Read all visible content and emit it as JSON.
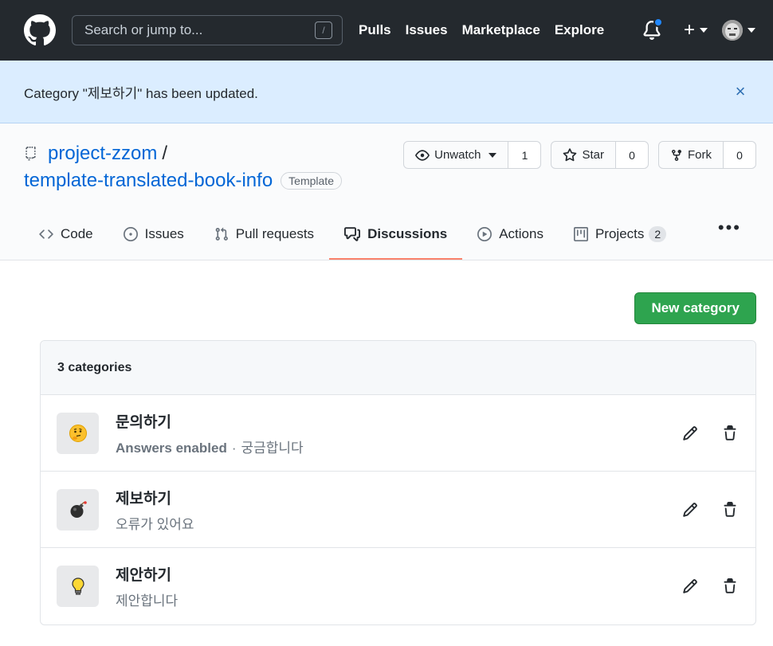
{
  "header": {
    "search_placeholder": "Search or jump to...",
    "search_shortcut": "/",
    "nav": [
      "Pulls",
      "Issues",
      "Marketplace",
      "Explore"
    ],
    "plus": "+"
  },
  "flash": {
    "message": "Category \"제보하기\" has been updated.",
    "close": "×"
  },
  "repo": {
    "owner": "project-zzom",
    "separator": "/",
    "name": "template-translated-book-info",
    "badge": "Template",
    "watch": {
      "label": "Unwatch",
      "count": "1"
    },
    "star": {
      "label": "Star",
      "count": "0"
    },
    "fork": {
      "label": "Fork",
      "count": "0"
    }
  },
  "tabs": [
    {
      "label": "Code"
    },
    {
      "label": "Issues"
    },
    {
      "label": "Pull requests"
    },
    {
      "label": "Discussions"
    },
    {
      "label": "Actions"
    },
    {
      "label": "Projects",
      "count": "2"
    }
  ],
  "more": "•••",
  "main": {
    "new_category_label": "New category",
    "categories_count_label": "3 categories",
    "categories": [
      {
        "emoji": "thinking-face",
        "title": "문의하기",
        "answers": "Answers enabled",
        "dot": "·",
        "description": "궁금합니다"
      },
      {
        "emoji": "bomb",
        "title": "제보하기",
        "description": "오류가 있어요"
      },
      {
        "emoji": "light-bulb",
        "title": "제안하기",
        "description": "제안합니다"
      }
    ]
  },
  "colors": {
    "header_bg": "#24292e",
    "flash_bg": "#dbedff",
    "link": "#0366d6",
    "accent_tab": "#f9826c",
    "primary_button": "#2ea44f",
    "notification_dot": "#2188ff"
  }
}
